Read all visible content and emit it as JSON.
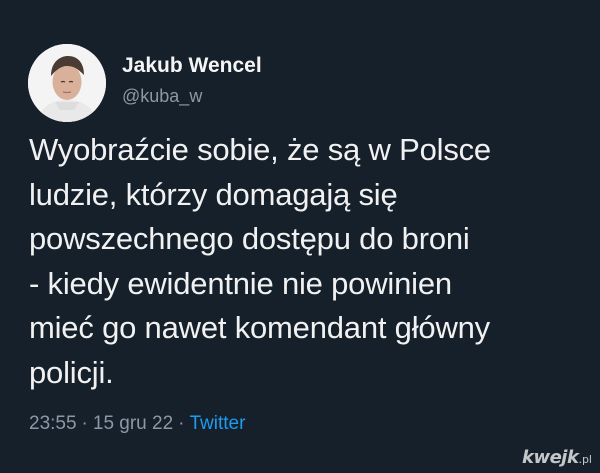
{
  "app": {
    "theme": "dark",
    "background": "#15202b"
  },
  "profile": {
    "display_name": "Jakub Wencel",
    "handle": "@kuba_w",
    "avatar_icon": "user-avatar"
  },
  "tweet": {
    "lines": [
      "Wyobraźcie sobie, że są w Polsce",
      "ludzie, którzy domagają się",
      "powszechnego dostępu do broni",
      "- kiedy ewidentnie nie powinien",
      "mieć go nawet komendant główny",
      "policji."
    ],
    "time": "23:55",
    "date": "15 gru 22",
    "source": "Twitter",
    "separator": "·"
  },
  "colors": {
    "text": "#f1f1f1",
    "secondary": "#8b98a5",
    "link": "#1d9bf0"
  },
  "watermark": {
    "brand": "kwejk",
    "tld": ".pl"
  }
}
